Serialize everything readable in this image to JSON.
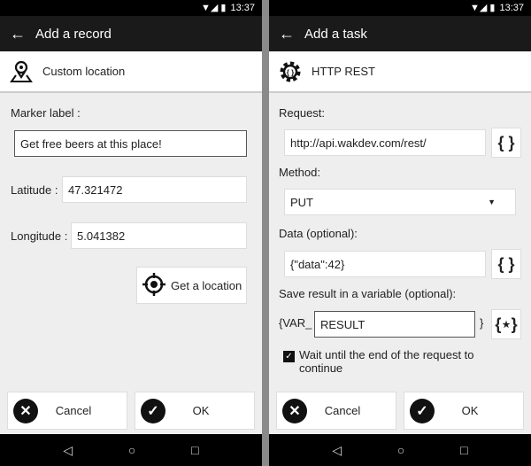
{
  "status": {
    "time": "13:37"
  },
  "left": {
    "title": "Add a record",
    "header": "Custom location",
    "marker_label": "Marker label :",
    "marker_value": "Get free beers at this place!",
    "latitude_label": "Latitude :",
    "latitude_value": "47.321472",
    "longitude_label": "Longitude :",
    "longitude_value": "5.041382",
    "get_location": "Get a location",
    "cancel": "Cancel",
    "ok": "OK"
  },
  "right": {
    "title": "Add a task",
    "header": "HTTP REST",
    "request_label": "Request:",
    "request_value": "http://api.wakdev.com/rest/",
    "method_label": "Method:",
    "method_value": "PUT",
    "data_label": "Data (optional):",
    "data_value": "{\"data\":42}",
    "save_label": "Save result in a variable (optional):",
    "var_prefix": "{VAR_",
    "var_value": "RESULT",
    "var_suffix": "}",
    "braces": "{ }",
    "braces_star": "{⋆}",
    "wait_label": "Wait until the end of the request to continue",
    "wait_checked": true,
    "cancel": "Cancel",
    "ok": "OK"
  }
}
